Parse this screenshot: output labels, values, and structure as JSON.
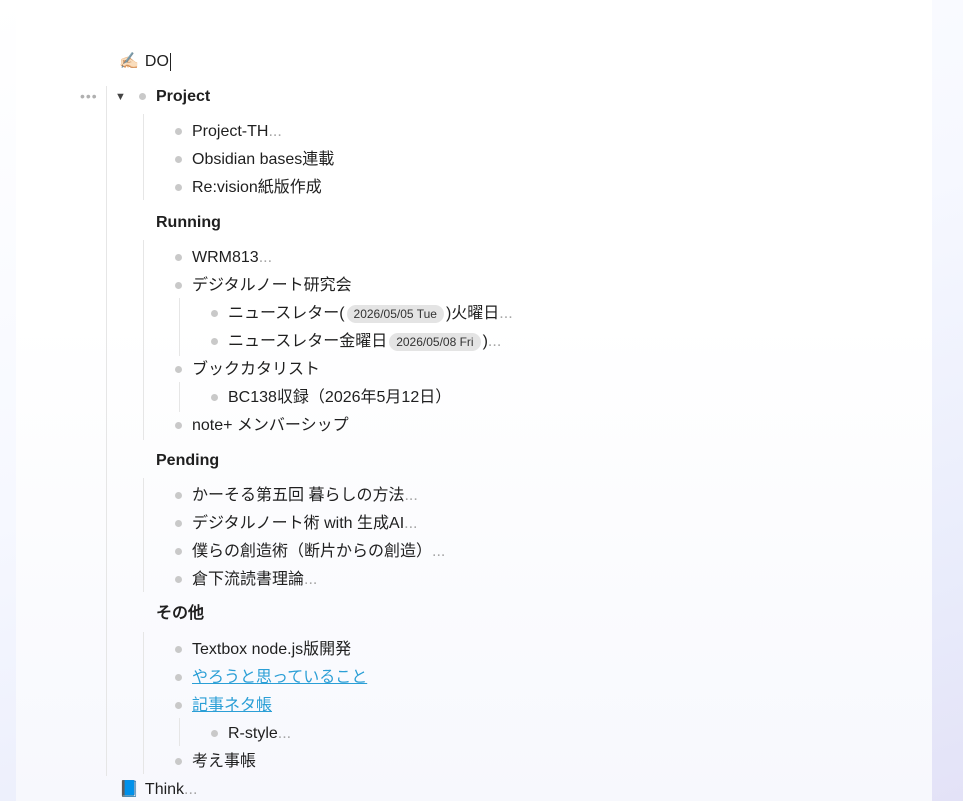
{
  "root": {
    "icon": "✍🏻",
    "title": "DO"
  },
  "sections": {
    "project": {
      "title": "Project",
      "items": [
        {
          "text": "Project-TH",
          "ellipsis": "..."
        },
        {
          "text": "Obsidian bases連載"
        },
        {
          "text": "Re:vision紙版作成"
        }
      ]
    },
    "running": {
      "title": "Running",
      "items": [
        {
          "text": "WRM813",
          "ellipsis": "..."
        },
        {
          "text": "デジタルノート研究会"
        },
        {
          "pre": "ニュースレター(",
          "chip": "2026/05/05 Tue",
          "post": ")火曜日",
          "ellipsis": "..."
        },
        {
          "pre": "ニュースレター金曜日",
          "chip": "2026/05/08 Fri",
          "post": ")",
          "ellipsis": "..."
        },
        {
          "text": "ブックカタリスト"
        },
        {
          "text": "BC138収録（2026年5月12日）"
        },
        {
          "text": "note+ メンバーシップ"
        }
      ]
    },
    "pending": {
      "title": "Pending",
      "items": [
        {
          "text": "かーそる第五回 暮らしの方法",
          "ellipsis": "..."
        },
        {
          "text": "デジタルノート術 with 生成AI",
          "ellipsis": "..."
        },
        {
          "text": "僕らの創造術（断片からの創造）",
          "ellipsis": "..."
        },
        {
          "text": "倉下流読書理論",
          "ellipsis": "..."
        }
      ]
    },
    "other": {
      "title": "その他",
      "items": [
        {
          "text": "Textbox node.js版開発"
        },
        {
          "text": "やろうと思っていること"
        },
        {
          "text": "記事ネタ帳"
        },
        {
          "text": "R-style",
          "ellipsis": "..."
        },
        {
          "text": "考え事帳"
        }
      ]
    }
  },
  "sibling": {
    "icon": "📘",
    "title": "Think",
    "ellipsis": "..."
  },
  "controls": {
    "more": "•••",
    "toggle": "▼"
  }
}
